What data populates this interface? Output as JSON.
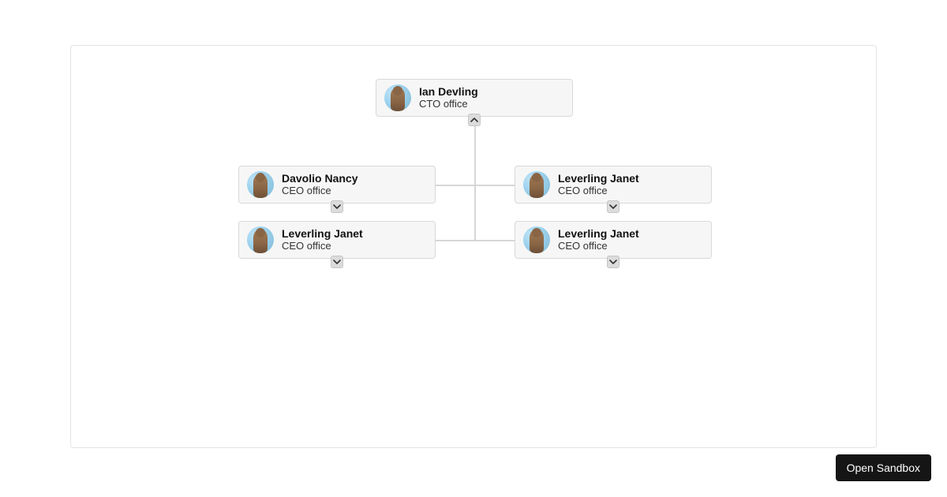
{
  "org": {
    "root": {
      "name": "Ian Devling",
      "title": "CTO office",
      "toggle_direction": "up"
    },
    "children": [
      {
        "name": "Davolio Nancy",
        "title": "CEO office",
        "toggle_direction": "down"
      },
      {
        "name": "Leverling Janet",
        "title": "CEO office",
        "toggle_direction": "down"
      },
      {
        "name": "Leverling Janet",
        "title": "CEO office",
        "toggle_direction": "down"
      },
      {
        "name": "Leverling Janet",
        "title": "CEO office",
        "toggle_direction": "down"
      }
    ]
  },
  "buttons": {
    "open_sandbox": "Open Sandbox"
  }
}
